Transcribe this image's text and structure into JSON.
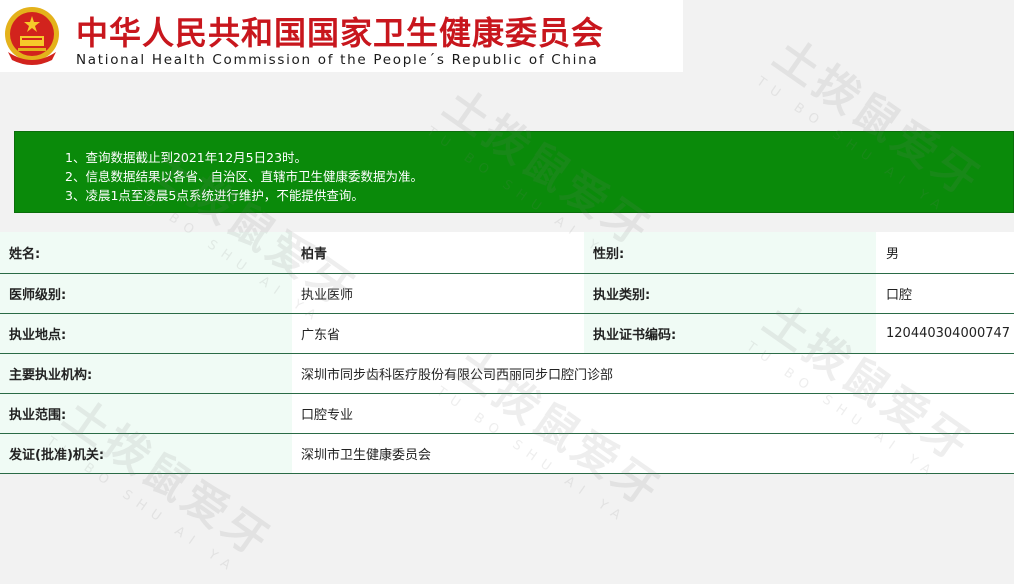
{
  "header": {
    "title_cn": "中华人民共和国国家卫生健康委员会",
    "title_en": "National Health Commission of the People´s Republic of China"
  },
  "notice": {
    "lines": [
      "1、查询数据截止到2021年12月5日23时。",
      "2、信息数据结果以各省、自治区、直辖市卫生健康委数据为准。",
      "3、凌晨1点至凌晨5点系统进行维护，不能提供查询。"
    ]
  },
  "record": {
    "name_label": "姓名:",
    "name_value": "柏青",
    "gender_label": "性别:",
    "gender_value": "男",
    "level_label": "医师级别:",
    "level_value": "执业医师",
    "category_label": "执业类别:",
    "category_value": "口腔",
    "location_label": "执业地点:",
    "location_value": "广东省",
    "cert_label": "执业证书编码:",
    "cert_value": "120440304000747",
    "institution_label": "主要执业机构:",
    "institution_value": "深圳市同步齿科医疗股份有限公司西丽同步口腔门诊部",
    "scope_label": "执业范围:",
    "scope_value": "口腔专业",
    "authority_label": "发证(批准)机关:",
    "authority_value": "深圳市卫生健康委员会"
  },
  "watermark": {
    "text": "土拨鼠爱牙",
    "pinyin": "TU BO SHU AI YA"
  },
  "colors": {
    "brand_red": "#c8161d",
    "notice_green": "#0a8a0a",
    "label_bg": "#f0fbf5",
    "row_border": "#2a6b46"
  },
  "icons": {
    "emblem": "national-emblem-icon"
  }
}
